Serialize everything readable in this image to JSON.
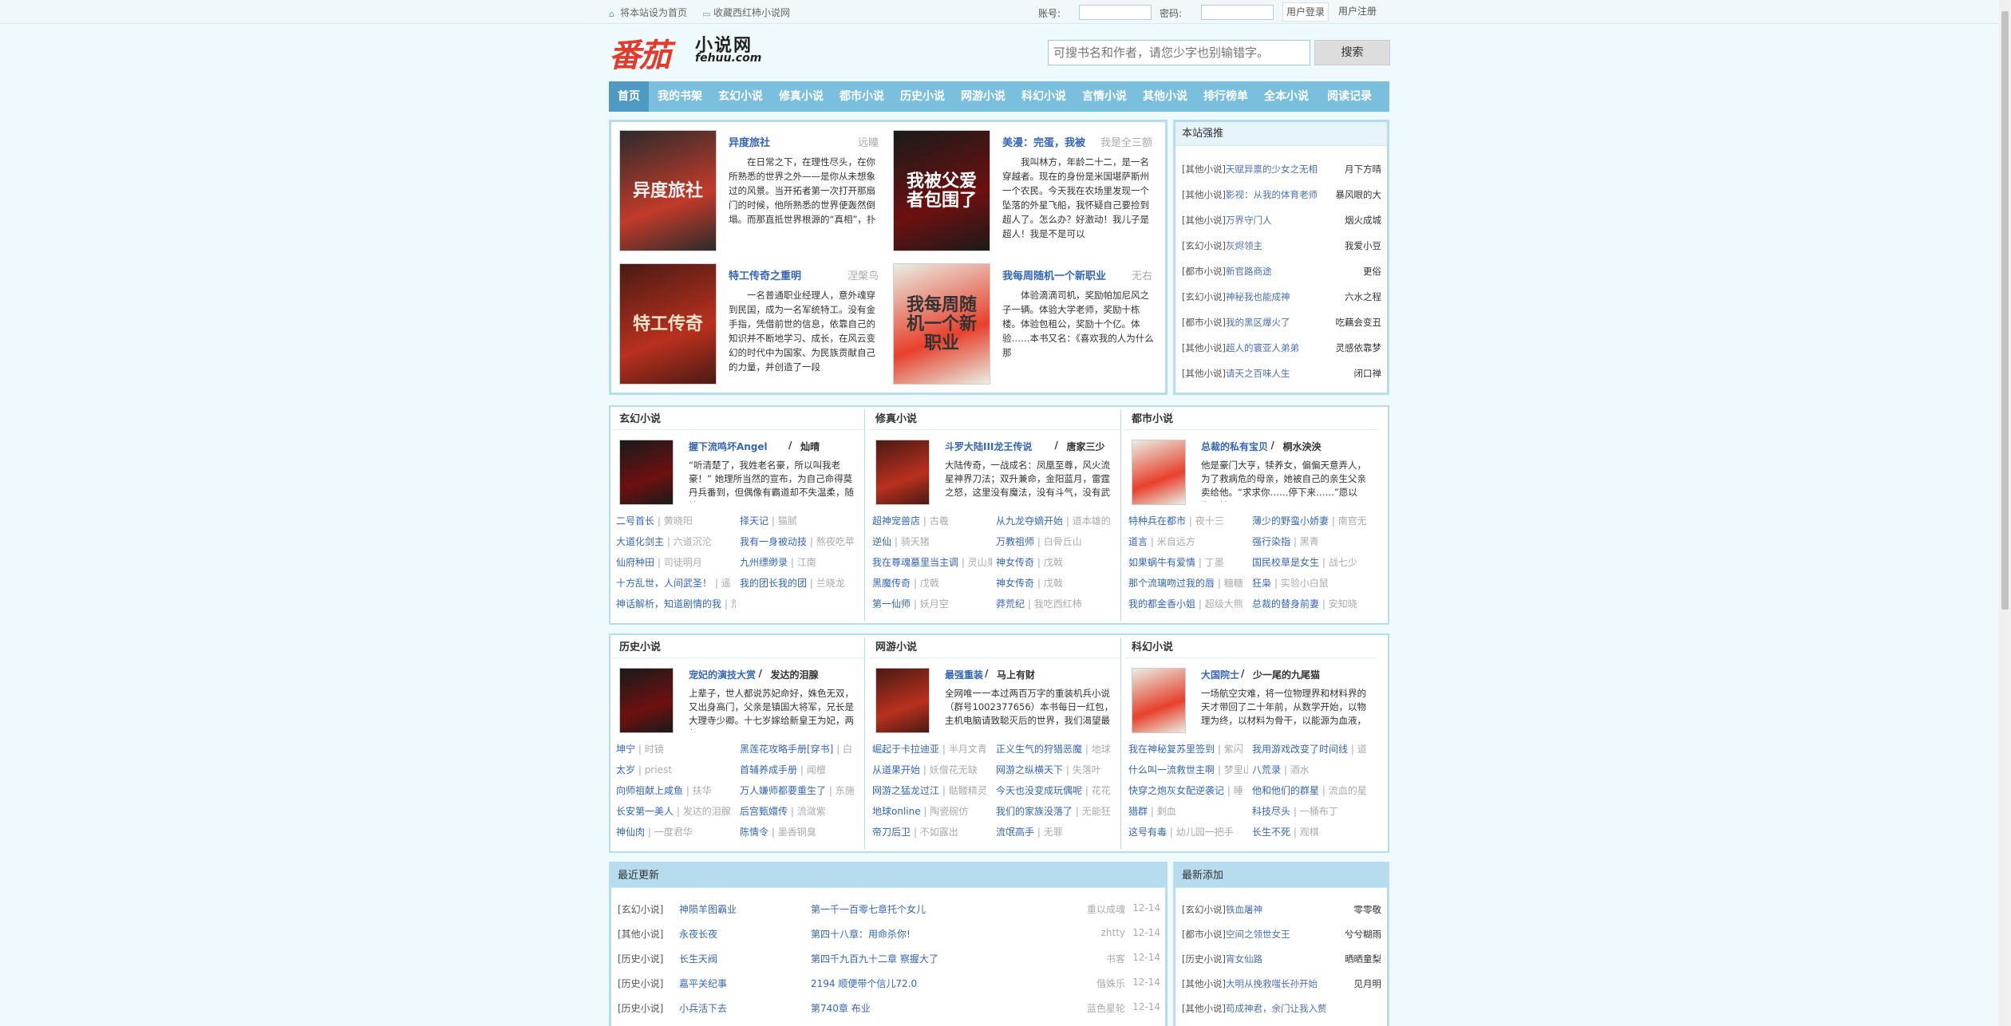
{
  "topbar": {
    "set_home": "将本站设为首页",
    "bookmark": "收藏西红柿小说网",
    "account_label": "账号:",
    "password_label": "密码:",
    "login": "用户登录",
    "register": "用户注册"
  },
  "logo": {
    "big": "番茄",
    "small": "小说网",
    "domain": "fehuu.com"
  },
  "search": {
    "placeholder": "可搜书名和作者，请您少字也别输错字。",
    "button": "搜索"
  },
  "nav": [
    "首页",
    "我的书架",
    "玄幻小说",
    "修真小说",
    "都市小说",
    "历史小说",
    "网游小说",
    "科幻小说",
    "言情小说",
    "其他小说",
    "排行榜单",
    "全本小说",
    "阅读记录"
  ],
  "featured": [
    {
      "title": "异度旅社",
      "author": "远瞳",
      "cover_text": "异度旅社",
      "desc": "　　在日常之下，在理性尽头，在你所熟悉的世界之外——是你从未想象过的风景。当开拓者第一次打开那扇门的时候，他所熟悉的世界便轰然倒塌。而那直抵世界根源的“真相”，扑"
    },
    {
      "title": "美漫：完蛋，我被",
      "author": "我是全三额",
      "cover_text": "我被父爱者包围了",
      "desc": "　　我叫林方，年龄二十二，是一名穿越者。现在的身份是米国堪萨斯州一个农民。今天我在农场里发现一个坠落的外星飞船，我怀疑自己要捡到超人了。怎么办？好激动！我儿子是超人！我是不是可以"
    },
    {
      "title": "特工传奇之重明",
      "author": "涅槃鸟",
      "cover_text": "特工传奇",
      "desc": "　　一名普通职业经理人，意外魂穿到民国，成为一名军统特工。没有金手指，凭借前世的信息，依靠自己的知识并不断地学习、成长，在风云变幻的时代中为国家、为民族贡献自己的力量，并创造了一段"
    },
    {
      "title": "我每周随机一个新职业",
      "author": "无右",
      "cover_text": "我每周随机一个新职业",
      "desc": "　　体验滴滴司机，奖励帕加尼风之子一辆。体验大学老师，奖励十栋楼。体验包租公，奖励十个亿。体验……本书又名：《喜欢我的人为什么那"
    }
  ],
  "strong": {
    "title": "本站强推",
    "items": [
      {
        "cat": "[其他小说]",
        "title": "天赋异禀的少女之无相",
        "author": "月下方晴"
      },
      {
        "cat": "[其他小说]",
        "title": "影视：从我的体育老师",
        "author": "暴风眼的大"
      },
      {
        "cat": "[其他小说]",
        "title": "万界守门人",
        "author": "烟火成城"
      },
      {
        "cat": "[玄幻小说]",
        "title": "灰烬领主",
        "author": "我爱小豆"
      },
      {
        "cat": "[都市小说]",
        "title": "新官路商途",
        "author": "更俗"
      },
      {
        "cat": "[玄幻小说]",
        "title": "神秘我也能成神",
        "author": "六水之程"
      },
      {
        "cat": "[都市小说]",
        "title": "我的黑区爆火了",
        "author": "吃藕会变丑"
      },
      {
        "cat": "[其他小说]",
        "title": "超人的寰亚人弟弟",
        "author": "灵感依靠梦"
      },
      {
        "cat": "[其他小说]",
        "title": "请天之百味人生",
        "author": "闭口禅"
      }
    ]
  },
  "categories1": [
    {
      "name": "玄幻小说",
      "top": {
        "title": "握下流鸣坏Angel",
        "author": "灿晴",
        "desc": "“听清楚了，我姓老名豪，所以叫我老豪！” 她理所当然的宣布，为自己命得莫丹兵番到，但偶像有霸道却不失温柔，随妹又"
      },
      "list": [
        [
          "二号首长",
          "黄晓阳"
        ],
        [
          "择天记",
          "猫腻"
        ],
        [
          "大道化剑主",
          "六道沉沦"
        ],
        [
          "我有一身被动技",
          "熬夜吃苹"
        ],
        [
          "仙府种田",
          "司徒明月"
        ],
        [
          "九州缥缈录",
          "江南"
        ],
        [
          "十方乱世，人间武圣！",
          "遥"
        ],
        [
          "我的团长我的团",
          "兰晓龙"
        ],
        [
          "神话解析，知道剧情的我",
          "荒古禁区传道百年，狠人"
        ]
      ]
    },
    {
      "name": "修真小说",
      "top": {
        "title": "斗罗大陆III龙王传说",
        "author": "唐家三少",
        "desc": "大陆传奇，一战成名：凤凰至尊，风火流星神界刀法；双升兼命，金阳蓝月，雷霆之怒，这里没有魔法，没有斗气，没有武"
      },
      "list": [
        [
          "超神宠兽店",
          "古羲"
        ],
        [
          "从九龙夺嫡开始",
          "道本雄的"
        ],
        [
          "逆仙",
          "骑天猪"
        ],
        [
          "万教祖师",
          "白骨丘山"
        ],
        [
          "我在尊魂墓里当主调",
          "灵山果粒"
        ],
        [
          "神女传奇",
          "戊戟"
        ],
        [
          "黑魔传奇",
          "戊戟"
        ],
        [
          "神女传奇",
          "戊戟"
        ],
        [
          "第一仙师",
          "妖月空"
        ],
        [
          "莽荒纪",
          "我吃西红柿"
        ]
      ]
    },
    {
      "name": "都市小说",
      "top": {
        "title": "总裁的私有宝贝",
        "author": "桐水泱泱",
        "desc": "他是豪门大亨，犊养女，偏偏天意弄人，为了救病危的母亲，她被自己的亲生父亲卖给他。“求求你……停下来……”愿以为，她"
      },
      "list": [
        [
          "特种兵在都市",
          "夜十三"
        ],
        [
          "薄少的野蛮小娇妻",
          "南官无"
        ],
        [
          "道言",
          "米自远方"
        ],
        [
          "强行染指",
          "黑青"
        ],
        [
          "如果蜗牛有爱情",
          "丁墨"
        ],
        [
          "国民校草是女生",
          "战七少"
        ],
        [
          "那个流璃吻过我的唇",
          "糖糖"
        ],
        [
          "狂枭",
          "实验小白鼠"
        ],
        [
          "我的都金香小姐",
          "超级大熊"
        ],
        [
          "总裁的替身前妻",
          "安知晓"
        ]
      ]
    }
  ],
  "categories2": [
    {
      "name": "历史小说",
      "top": {
        "title": "宠妃的演技大赏",
        "author": "发达的泪腺",
        "desc": "上辈子，世人都说苏妃命好，姝色无双，又出身高门，父亲是镇国大将军，兄长是大理寺少卿。十七岁嫁给新皇王为妃，两年"
      },
      "list": [
        [
          "坤宁",
          "时镜"
        ],
        [
          "黑莲花攻略手册[穿书]",
          "白"
        ],
        [
          "太岁",
          "priest"
        ],
        [
          "首辅养成手册",
          "闻檀"
        ],
        [
          "向师祖献上咸鱼",
          "扶华"
        ],
        [
          "万人嫌师都要重生了",
          "东施"
        ],
        [
          "长安第一美人",
          "发达的泪腺"
        ],
        [
          "后宫甄嬛传",
          "流潋紫"
        ],
        [
          "神仙肉",
          "一度君华"
        ],
        [
          "陈情令",
          "墨香铜臭"
        ]
      ]
    },
    {
      "name": "网游小说",
      "top": {
        "title": "最强重装",
        "author": "马上有财",
        "desc": "全网唯一一本过两百万字的重装机兵小说（群号1002377656）本书每日一红包，主机电脑请致聪灭后的世界，我们渴望最"
      },
      "list": [
        [
          "崛起于卡拉迪亚",
          "半月文青"
        ],
        [
          "正义生气的狩猎恶魔",
          "地球"
        ],
        [
          "从道果开始",
          "妖僧花无缺"
        ],
        [
          "网游之纵横天下",
          "失落叶"
        ],
        [
          "网游之猛龙过江",
          "骷髅精灵"
        ],
        [
          "今天也没变成玩偶呢",
          "花花"
        ],
        [
          "地球online",
          "陶瓷碗仿"
        ],
        [
          "我们的家族没落了",
          "无能狂"
        ],
        [
          "帝刀后卫",
          "不如露出"
        ],
        [
          "流氓高手",
          "无罪"
        ]
      ]
    },
    {
      "name": "科幻小说",
      "top": {
        "title": "大国院士",
        "author": "少一尾的九尾猫",
        "desc": "一场航空灾难，将一位物理界和材料界的天才带回了二十年前，从数学开始，以物理为终，以材料为骨干，以能源为血液，"
      },
      "list": [
        [
          "我在神秘复苏里签到",
          "紫闪"
        ],
        [
          "我用游戏改变了时间线",
          "道"
        ],
        [
          "什么叫一流救世主啊",
          "梦里山海"
        ],
        [
          "八荒录",
          "酒水"
        ],
        [
          "快穿之炮灰女配逆袭记",
          "睡"
        ],
        [
          "他和他们的群星",
          "流血的星"
        ],
        [
          "猎群",
          "剩血"
        ],
        [
          "科技尽头",
          "一桶布丁"
        ],
        [
          "这号有毒",
          "幼儿园一把手"
        ],
        [
          "长生不死",
          "观棋"
        ]
      ]
    }
  ],
  "recent": {
    "title": "最近更新",
    "items": [
      {
        "cat": "[玄幻小说]",
        "title": "神陨羊图霸业",
        "chapter": "第一千一百零七章托个女儿",
        "author": "重以成魂",
        "date": "12-14"
      },
      {
        "cat": "[其他小说]",
        "title": "永夜长夜",
        "chapter": "第四十八章：用命杀你!",
        "author": "zhtty",
        "date": "12-14"
      },
      {
        "cat": "[历史小说]",
        "title": "长生天阀",
        "chapter": "第四千九百九十二章 察握大了",
        "author": "书客",
        "date": "12-14"
      },
      {
        "cat": "[历史小说]",
        "title": "嘉平关纪事",
        "chapter": "2194 顺便带个信儿72.0",
        "author": "偕姝乐",
        "date": "12-14"
      },
      {
        "cat": "[历史小说]",
        "title": "小兵活下去",
        "chapter": "第740章 布业",
        "author": "蓝色星轮",
        "date": "12-14"
      }
    ]
  },
  "newest": {
    "title": "最新添加",
    "items": [
      {
        "cat": "[玄幻小说]",
        "title": "铁血屠神",
        "author": "零零敬"
      },
      {
        "cat": "[都市小说]",
        "title": "空间之领世女王",
        "author": "兮兮糊雨"
      },
      {
        "cat": "[历史小说]",
        "title": "宵女仙路",
        "author": "晒晒童梨"
      },
      {
        "cat": "[其他小说]",
        "title": "大明从挽救嗤长孙开始",
        "author": "见月明"
      },
      {
        "cat": "[其他小说]",
        "title": "苟成神君，余门让我入赘",
        "author": ""
      }
    ]
  }
}
